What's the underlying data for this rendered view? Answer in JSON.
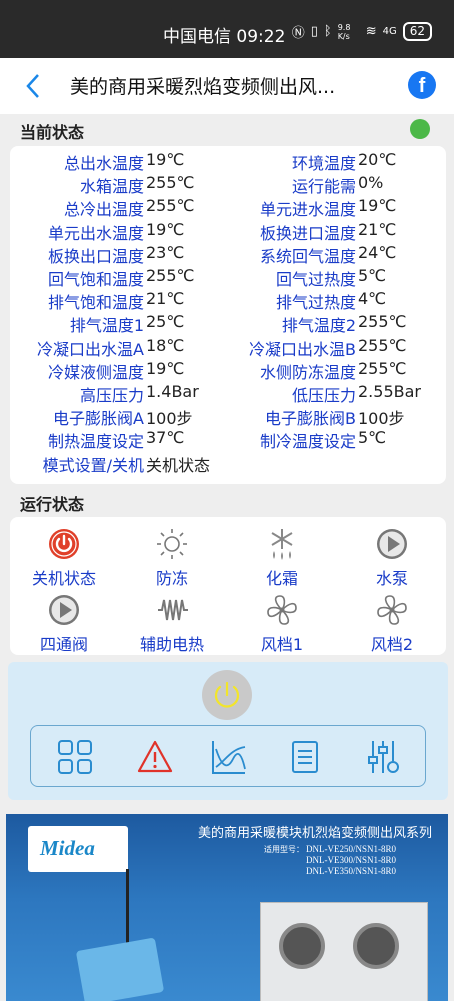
{
  "status_bar": {
    "carrier_time": "中国电信 09:22",
    "signal_speed": "9.8 K/s",
    "network": "4G",
    "battery": "62"
  },
  "header": {
    "title": "美的商用采暖烈焰变频侧出风...",
    "facebook_letter": "f"
  },
  "current_status": {
    "title": "当前状态",
    "indicator_color": "#4cb848",
    "rows": [
      {
        "l1": "总出水温度",
        "v1": "19℃",
        "l2": "环境温度",
        "v2": "20℃"
      },
      {
        "l1": "水箱温度",
        "v1": "255℃",
        "l2": "运行能需",
        "v2": "0%"
      },
      {
        "l1": "总冷出温度",
        "v1": "255℃",
        "l2": "单元进水温度",
        "v2": "19℃"
      },
      {
        "l1": "单元出水温度",
        "v1": "19℃",
        "l2": "板换进口温度",
        "v2": "21℃"
      },
      {
        "l1": "板换出口温度",
        "v1": "23℃",
        "l2": "系统回气温度",
        "v2": "24℃"
      },
      {
        "l1": "回气饱和温度",
        "v1": "255℃",
        "l2": "回气过热度",
        "v2": "5℃"
      },
      {
        "l1": "排气饱和温度",
        "v1": "21℃",
        "l2": "排气过热度",
        "v2": "4℃"
      },
      {
        "l1": "排气温度1",
        "v1": "25℃",
        "l2": "排气温度2",
        "v2": "255℃"
      },
      {
        "l1": "冷凝口出水温A",
        "v1": "18℃",
        "l2": "冷凝口出水温B",
        "v2": "255℃"
      },
      {
        "l1": "冷媒液侧温度",
        "v1": "19℃",
        "l2": "水侧防冻温度",
        "v2": "255℃"
      },
      {
        "l1": "高压压力",
        "v1": "1.4Bar",
        "l2": "低压压力",
        "v2": "2.55Bar"
      },
      {
        "l1": "电子膨胀阀A",
        "v1": "100步",
        "l2": "电子膨胀阀B",
        "v2": "100步"
      },
      {
        "l1": "制热温度设定",
        "v1": "37℃",
        "l2": "制冷温度设定",
        "v2": "5℃"
      },
      {
        "l1": "模式设置/关机",
        "v1": "关机状态",
        "l2": "",
        "v2": ""
      }
    ]
  },
  "run_status": {
    "title": "运行状态",
    "items": [
      {
        "label": "关机状态",
        "icon": "power-icon"
      },
      {
        "label": "防冻",
        "icon": "sun-icon"
      },
      {
        "label": "化霜",
        "icon": "snowflake-icon"
      },
      {
        "label": "水泵",
        "icon": "play-icon"
      },
      {
        "label": "四通阀",
        "icon": "play-icon"
      },
      {
        "label": "辅助电热",
        "icon": "heater-icon"
      },
      {
        "label": "风档1",
        "icon": "fan-icon"
      },
      {
        "label": "风档2",
        "icon": "fan-icon"
      }
    ]
  },
  "controls": {
    "power_icon": "power-icon",
    "buttons": [
      "grid-icon",
      "warning-icon",
      "chart-icon",
      "list-icon",
      "settings-sliders-icon"
    ]
  },
  "banner": {
    "logo": "Midea",
    "title": "美的商用采暖模块机烈焰变频侧出风系列",
    "models_label": "适用型号：",
    "models": [
      "DNL-VE250/NSN1-8R0",
      "DNL-VE300/NSN1-8R0",
      "DNL-VE350/NSN1-8R0"
    ]
  },
  "colors": {
    "label_blue": "#1a3cc8",
    "power_red": "#e0402a",
    "control_bg": "#d7ebf8"
  }
}
